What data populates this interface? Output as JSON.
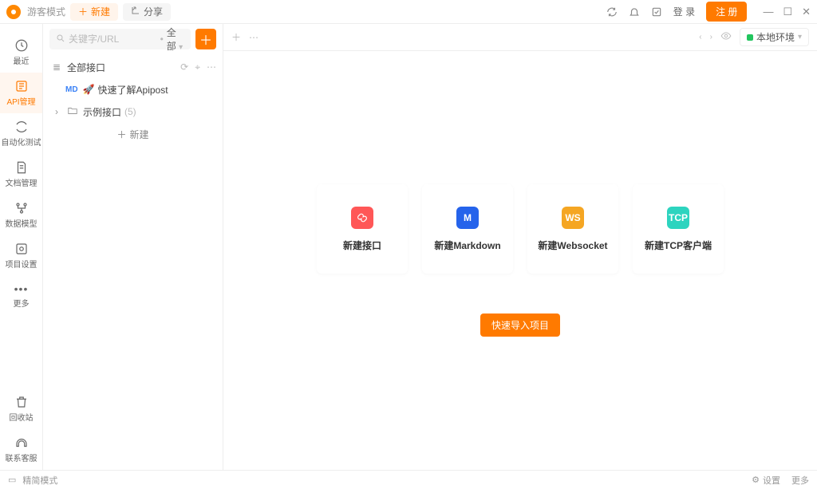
{
  "titlebar": {
    "guest_mode": "游客模式",
    "new_btn": "新建",
    "share_btn": "分享",
    "login": "登 录",
    "register": "注 册"
  },
  "leftnav": {
    "recent": "最近",
    "api": "API管理",
    "auto_test": "自动化测试",
    "docs": "文档管理",
    "data_model": "数据模型",
    "project_settings": "项目设置",
    "more": "更多",
    "recycle": "回收站",
    "contact": "联系客服"
  },
  "sidepanel": {
    "search_placeholder": "关键字/URL",
    "filter_label": "全部",
    "root_label": "全部接口",
    "quick_learn": "快速了解Apipost",
    "md_badge": "MD",
    "example_folder": "示例接口",
    "example_count": "(5)",
    "new_label": "新建"
  },
  "tabbar": {
    "env_label": "本地环境"
  },
  "dashboard": {
    "cards": [
      {
        "label": "新建接口",
        "bg": "#ff5757",
        "text": ""
      },
      {
        "label": "新建Markdown",
        "bg": "#2563eb",
        "text": "M"
      },
      {
        "label": "新建Websocket",
        "bg": "#f5a623",
        "text": "WS"
      },
      {
        "label": "新建TCP客户端",
        "bg": "#2dd4bf",
        "text": "TCP"
      }
    ],
    "import_btn": "快速导入项目"
  },
  "statusbar": {
    "mode": "精简模式",
    "settings": "设置",
    "more": "更多"
  }
}
